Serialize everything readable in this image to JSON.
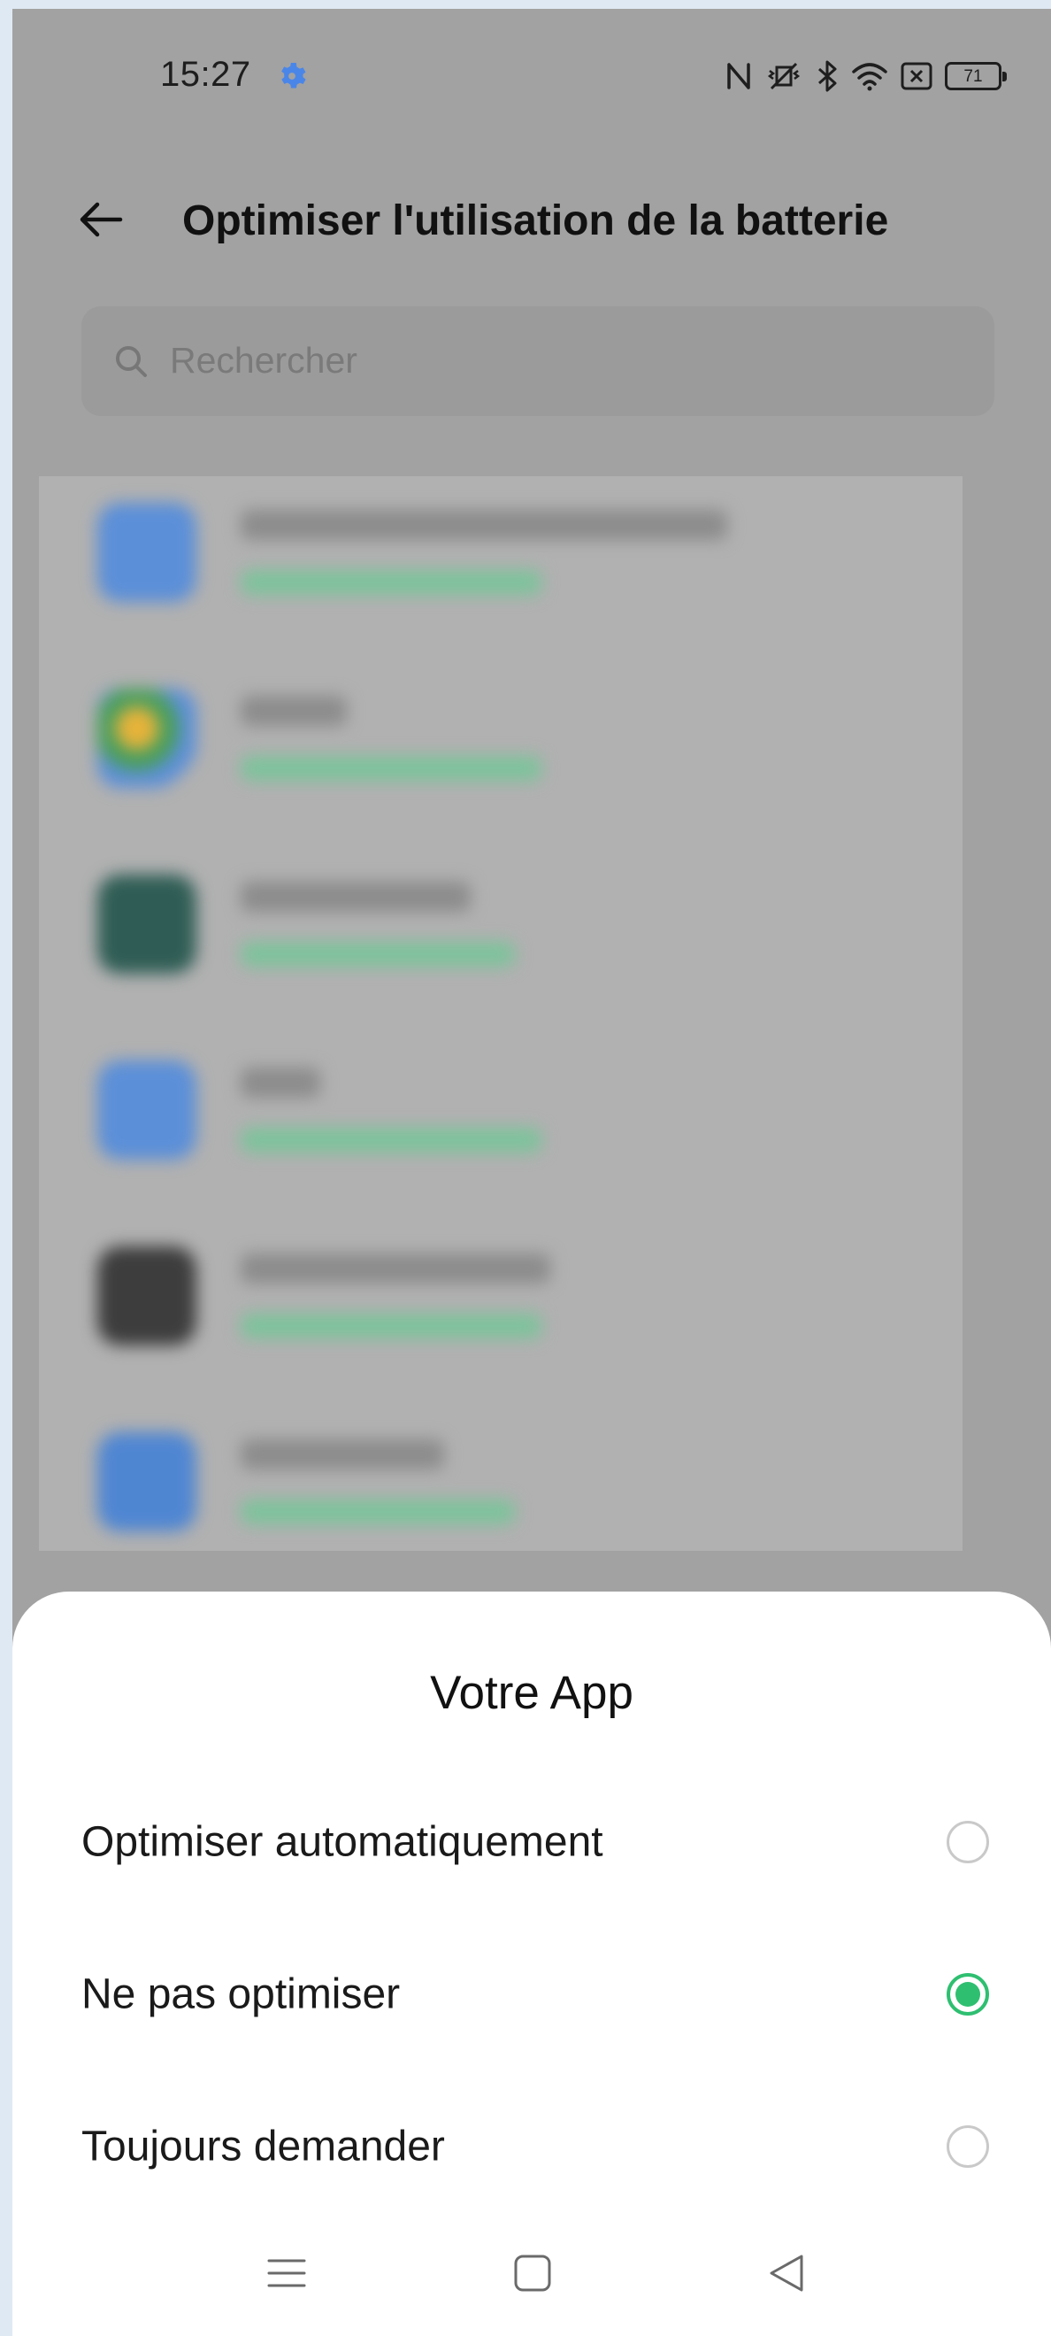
{
  "status_bar": {
    "time": "15:27",
    "battery": "71"
  },
  "header": {
    "title": "Optimiser l'utilisation de la batterie"
  },
  "search": {
    "placeholder": "Rechercher"
  },
  "blurred_list": {
    "icon_colors": [
      "#5b8fd8",
      "#6ea6a0",
      "#2f5d55",
      "#5b8fd8",
      "#3d3d3d",
      "#4f86d2"
    ]
  },
  "sheet": {
    "title": "Votre App",
    "options": [
      {
        "label": "Optimiser automatiquement",
        "selected": false
      },
      {
        "label": "Ne pas optimiser",
        "selected": true
      },
      {
        "label": "Toujours demander",
        "selected": false
      }
    ],
    "accent_color": "#2fbf71"
  },
  "nav": {
    "icons": [
      "menu-icon",
      "home-icon",
      "back-icon"
    ]
  }
}
